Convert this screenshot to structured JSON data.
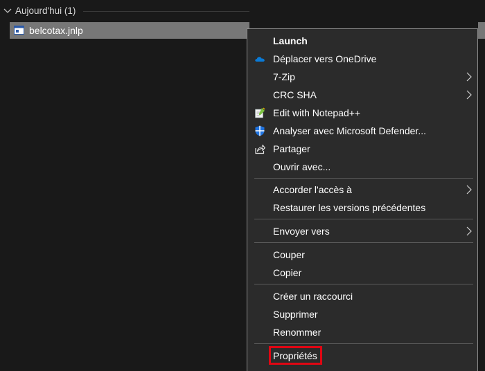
{
  "group": {
    "title": "Aujourd'hui (1)"
  },
  "file": {
    "name": "belcotax.jnlp"
  },
  "menu": {
    "launch": "Launch",
    "onedrive": "Déplacer vers OneDrive",
    "zip": "7-Zip",
    "crc": "CRC SHA",
    "notepad": "Edit with Notepad++",
    "defender": "Analyser avec Microsoft Defender...",
    "share": "Partager",
    "open_with": "Ouvrir avec...",
    "grant_access": "Accorder l'accès à",
    "restore": "Restaurer les versions précédentes",
    "send_to": "Envoyer vers",
    "cut": "Couper",
    "copy": "Copier",
    "shortcut": "Créer un raccourci",
    "delete": "Supprimer",
    "rename": "Renommer",
    "properties": "Propriétés"
  },
  "colors": {
    "background": "#191919",
    "menu_bg": "#2b2b2b",
    "selection": "#777777",
    "highlight_box": "#e00613",
    "onedrive": "#0a7ad6",
    "defender": "#1f73e0"
  },
  "icons": {
    "chevron": "chevron-down-icon",
    "file": "jnlp-file-icon",
    "onedrive": "onedrive-cloud-icon",
    "notepad": "notepad-plus-plus-icon",
    "defender": "defender-shield-icon",
    "share": "share-icon",
    "submenu": "chevron-right-icon"
  }
}
